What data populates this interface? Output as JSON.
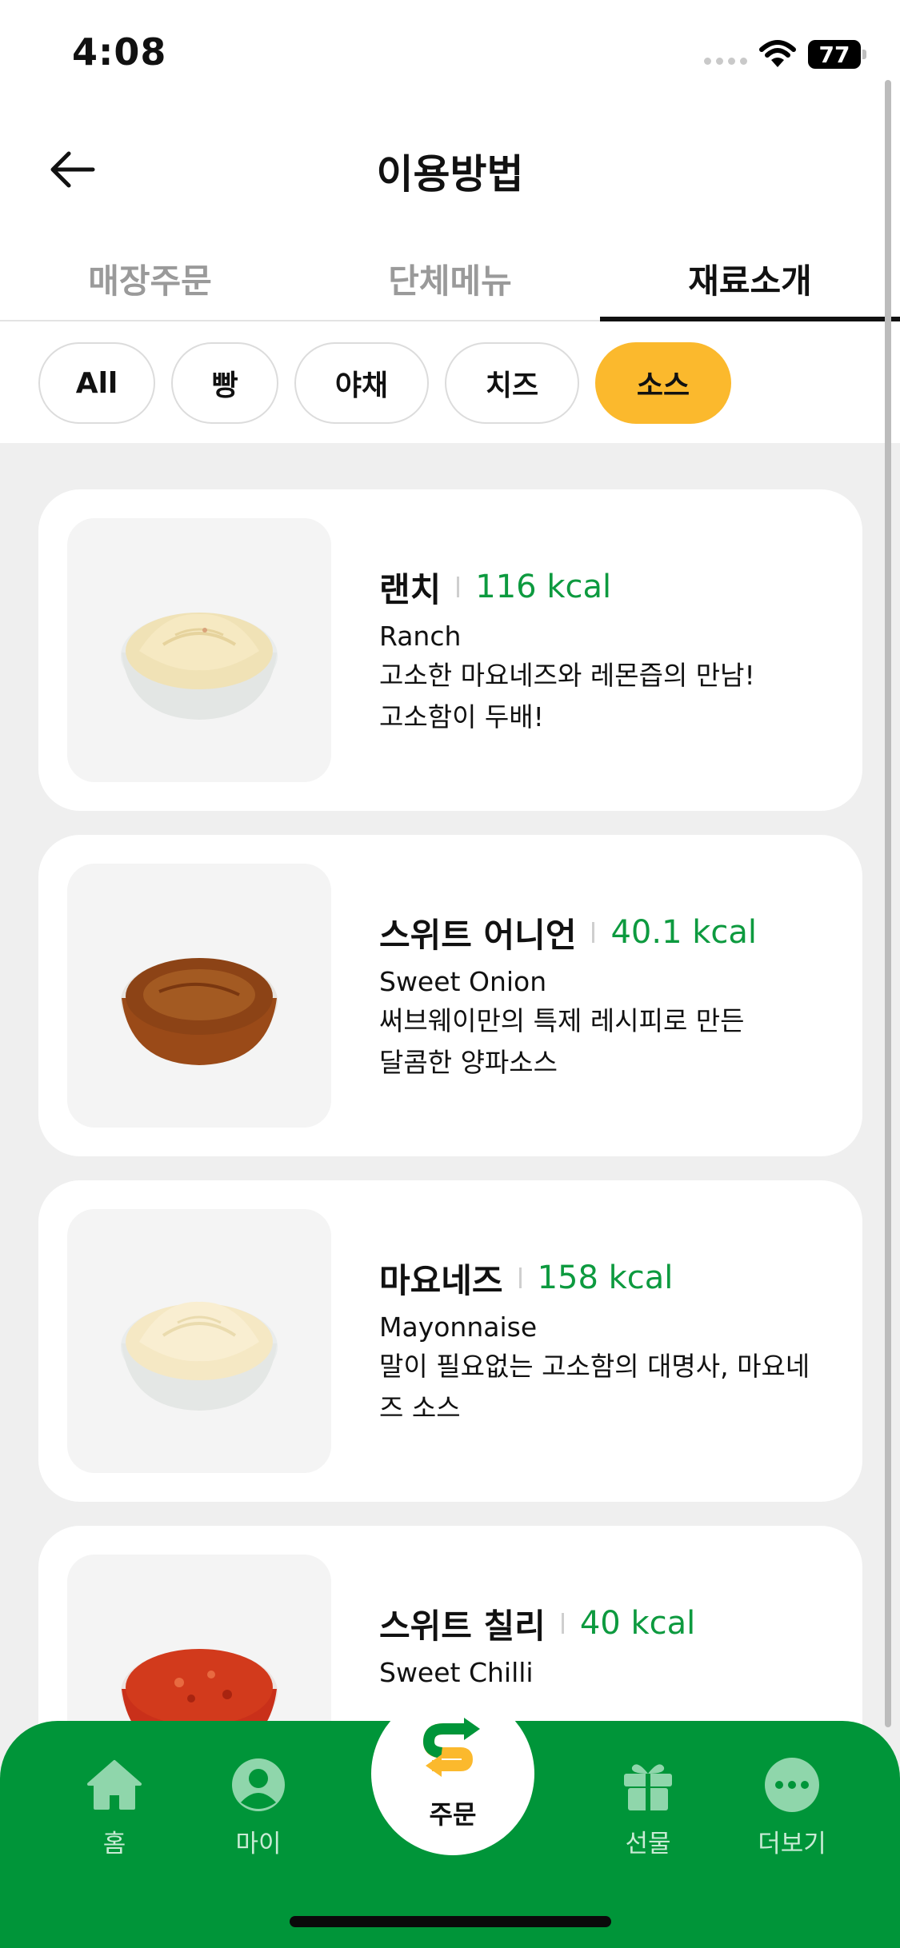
{
  "status_bar": {
    "time": "4:08",
    "battery": "77"
  },
  "header": {
    "title": "이용방법"
  },
  "tabs": [
    {
      "label": "매장주문",
      "active": false
    },
    {
      "label": "단체메뉴",
      "active": false
    },
    {
      "label": "재료소개",
      "active": true
    }
  ],
  "filters": [
    {
      "label": "All",
      "active": false
    },
    {
      "label": "빵",
      "active": false
    },
    {
      "label": "야채",
      "active": false
    },
    {
      "label": "치즈",
      "active": false
    },
    {
      "label": "소스",
      "active": true
    }
  ],
  "items": [
    {
      "name": "랜치",
      "kcal": "116 kcal",
      "english": "Ranch",
      "desc1": "고소한 마요네즈와 레몬즙의 만남!",
      "desc2": "고소함이 두배!",
      "image": "ranch-sauce-bowl"
    },
    {
      "name": "스위트 어니언",
      "kcal": "40.1 kcal",
      "english": "Sweet Onion",
      "desc1": "써브웨이만의 특제 레시피로 만든",
      "desc2": "달콤한 양파소스",
      "image": "sweet-onion-sauce-bowl"
    },
    {
      "name": "마요네즈",
      "kcal": "158 kcal",
      "english": "Mayonnaise",
      "desc1": "말이 필요없는 고소함의 대명사, 마요네",
      "desc2": "즈 소스",
      "image": "mayonnaise-sauce-bowl"
    },
    {
      "name": "스위트 칠리",
      "kcal": "40 kcal",
      "english": "Sweet Chilli",
      "desc1": "",
      "desc2": "",
      "image": "sweet-chilli-sauce-bowl"
    }
  ],
  "bottom_nav": {
    "home": "홈",
    "my": "마이",
    "order": "주문",
    "gift": "선물",
    "more": "더보기"
  },
  "colors": {
    "brand_green": "#009539",
    "kcal_green": "#0d9a3f",
    "accent_yellow": "#fbb92d"
  }
}
